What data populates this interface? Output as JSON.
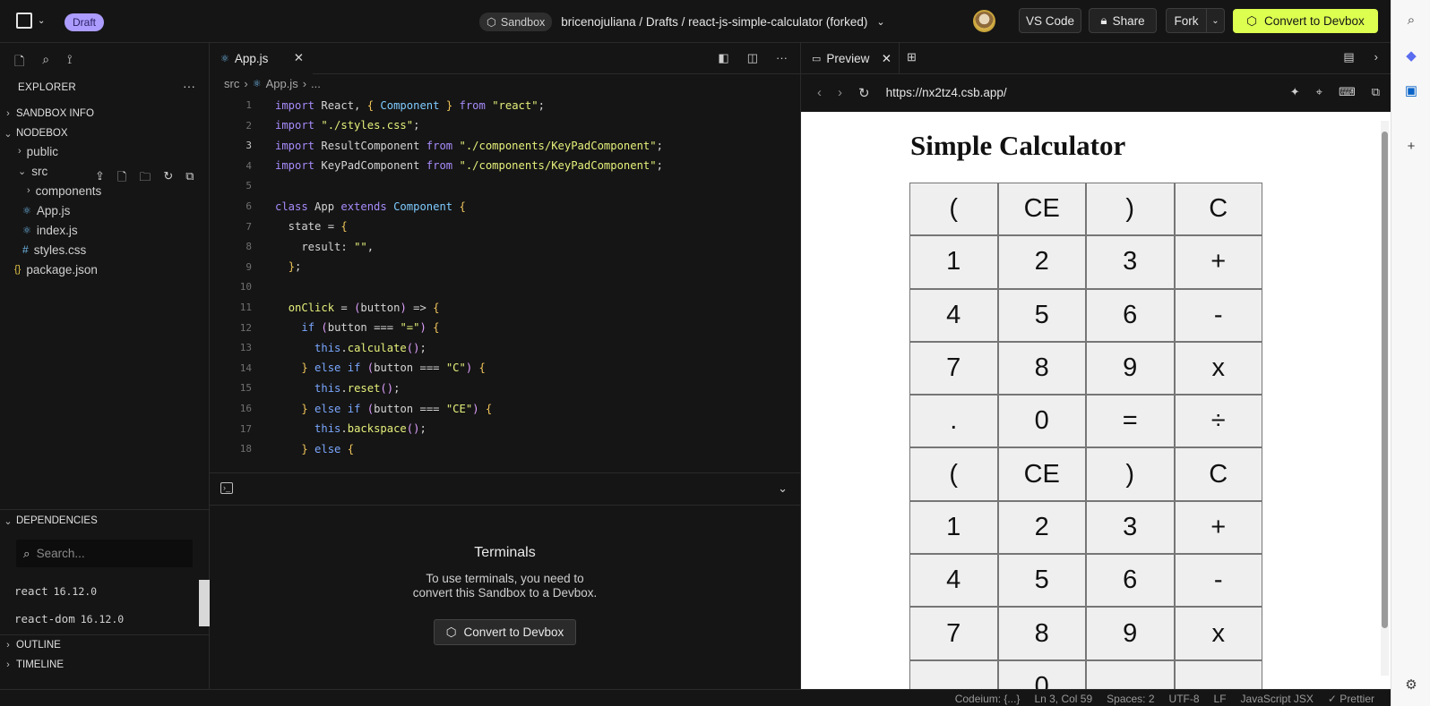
{
  "topbar": {
    "draft_label": "Draft",
    "sandbox_label": "Sandbox",
    "breadcrumb": "bricenojuliana / Drafts / react-js-simple-calculator (forked)",
    "vscode_label": "VS Code",
    "share_label": "Share",
    "fork_label": "Fork",
    "convert_label": "Convert to Devbox"
  },
  "sidebar": {
    "explorer_title": "EXPLORER",
    "sandbox_info": "SANDBOX INFO",
    "nodebox": "NODEBOX",
    "files": [
      {
        "label": "public",
        "kind": "folder"
      },
      {
        "label": "src",
        "kind": "folder-open"
      },
      {
        "label": "components",
        "kind": "folder"
      },
      {
        "label": "App.js",
        "kind": "react"
      },
      {
        "label": "index.js",
        "kind": "react"
      },
      {
        "label": "styles.css",
        "kind": "css"
      },
      {
        "label": "package.json",
        "kind": "json"
      }
    ],
    "dependencies_title": "DEPENDENCIES",
    "dep_search_placeholder": "Search...",
    "dependencies": [
      {
        "name": "react",
        "version": "16.12.0"
      },
      {
        "name": "react-dom",
        "version": "16.12.0"
      }
    ],
    "outline": "OUTLINE",
    "timeline": "TIMELINE"
  },
  "editor": {
    "tab_label": "App.js",
    "breadcrumb": {
      "folder": "src",
      "file": "App.js",
      "rest": "..."
    },
    "lines": [
      "import React, { Component } from \"react\";",
      "import \"./styles.css\";",
      "import ResultComponent from \"./components/KeyPadComponent\";",
      "import KeyPadComponent from \"./components/KeyPadComponent\";",
      "",
      "class App extends Component {",
      "  state = {",
      "    result: \"\",",
      "  };",
      "",
      "  onClick = (button) => {",
      "    if (button === \"=\") {",
      "      this.calculate();",
      "    } else if (button === \"C\") {",
      "      this.reset();",
      "    } else if (button === \"CE\") {",
      "      this.backspace();",
      "    } else {"
    ],
    "line_numbers": [
      "1",
      "2",
      "3",
      "4",
      "5",
      "6",
      "7",
      "8",
      "9",
      "10",
      "11",
      "12",
      "13",
      "14",
      "15",
      "16",
      "17",
      "18"
    ]
  },
  "terminal": {
    "title": "Terminals",
    "desc_line1": "To use terminals, you need to",
    "desc_line2": "convert this Sandbox to a Devbox.",
    "button_label": "Convert to Devbox"
  },
  "preview": {
    "tab_label": "Preview",
    "url": "https://nx2tz4.csb.app/",
    "app_title": "Simple Calculator",
    "keys": [
      "(",
      "CE",
      ")",
      "C",
      "1",
      "2",
      "3",
      "+",
      "4",
      "5",
      "6",
      "-",
      "7",
      "8",
      "9",
      "x",
      ".",
      "0",
      "=",
      "÷",
      "(",
      "CE",
      ")",
      "C",
      "1",
      "2",
      "3",
      "+",
      "4",
      "5",
      "6",
      "-",
      "7",
      "8",
      "9",
      "x",
      "",
      "0",
      "",
      ""
    ]
  },
  "status": {
    "codeium": "Codeium: {...}",
    "position": "Ln 3, Col 59",
    "spaces": "Spaces: 2",
    "encoding": "UTF-8",
    "eol": "LF",
    "language": "JavaScript JSX",
    "prettier": "✓ Prettier"
  },
  "colors": {
    "accent": "#dcff50",
    "draft_badge": "#ac9cff",
    "background": "#151515"
  },
  "icons": [
    "menu-square-icon",
    "chevron-down-icon",
    "sandbox-icon",
    "lock-icon",
    "cube-icon",
    "file-icon",
    "search-icon",
    "git-icon",
    "react-icon",
    "css-icon",
    "json-icon",
    "terminal-icon",
    "reload-icon",
    "preview-icon",
    "copilot-icon",
    "outlook-icon",
    "plus-icon",
    "gear-icon"
  ]
}
